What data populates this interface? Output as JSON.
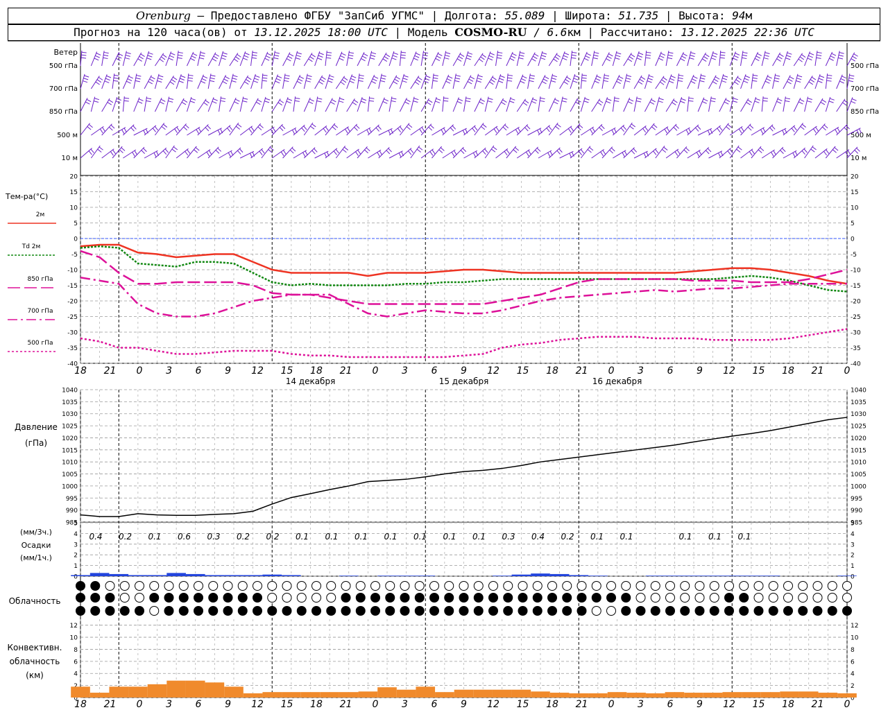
{
  "header": {
    "city": "Orenburg",
    "dash": "—",
    "provider": "Предоставлено ФГБУ \"ЗапСиб УГМС\"",
    "lon_label": "Долгота:",
    "lon": "55.089",
    "lat_label": "Широта:",
    "lat": "51.735",
    "alt_label": "Высота:",
    "alt": "94",
    "alt_unit": "м",
    "sep": "|",
    "forecast_prefix": "Прогноз на 120 часа(ов) от",
    "forecast_start": "13.12.2025 18:00 UTC",
    "model_label": "Модель",
    "model": "COSMO-RU",
    "model_res": "/ 6.6",
    "model_res_unit": "км",
    "computed_label": "Рассчитано:",
    "computed": "13.12.2025 22:36 UTC"
  },
  "time_axis": {
    "hour_labels": [
      "18",
      "21",
      "0",
      "3",
      "6",
      "9",
      "12",
      "15",
      "18",
      "21",
      "0",
      "3",
      "6",
      "9",
      "12",
      "15",
      "18",
      "21",
      "0",
      "3",
      "6",
      "9",
      "12",
      "15",
      "18",
      "21",
      "0"
    ],
    "day_labels": [
      "14 декабря",
      "15 декабря",
      "16 декабря"
    ]
  },
  "wind_panel": {
    "title": "Ветер",
    "levels": [
      "500 гПа",
      "700 гПа",
      "850 гПа",
      "500 м",
      "10 м"
    ],
    "color": "#6a1fc8"
  },
  "temp_panel": {
    "title": "Тем-ра(°C)",
    "legend": [
      "2м",
      "Td 2м",
      "850 гПа",
      "700 гПа",
      "500 гПа"
    ],
    "ticks": [
      "20",
      "15",
      "10",
      "5",
      "0",
      "-5",
      "-10",
      "-15",
      "-20",
      "-25",
      "-30",
      "-35",
      "-40"
    ]
  },
  "pressure_panel": {
    "title": "Давление",
    "unit": "(гПа)",
    "ticks": [
      "1040",
      "1035",
      "1030",
      "1025",
      "1020",
      "1015",
      "1010",
      "1005",
      "1000",
      "995",
      "990",
      "985"
    ]
  },
  "precip_panel": {
    "title": "Осадки",
    "unit_3h": "(мм/3ч.)",
    "unit_1h": "(мм/1ч.)",
    "ticks": [
      "5",
      "4",
      "3",
      "2",
      "1",
      "0"
    ],
    "amounts_3h": [
      "0.4",
      "0.2",
      "0.1",
      "0.6",
      "0.3",
      "0.2",
      "0.2",
      "0.1",
      "0.1",
      "0.1",
      "0.1",
      "0.1",
      "0.1",
      "0.1",
      "0.3",
      "0.4",
      "0.2",
      "0.1",
      "0.1",
      "",
      "0.1",
      "0.1",
      "0.1",
      "",
      "",
      "",
      ""
    ]
  },
  "cloud_panel": {
    "title": "Облачность"
  },
  "conv_panel": {
    "title_1": "Конвективн.",
    "title_2": "облачность",
    "unit": "(км)",
    "ticks": [
      "12",
      "10",
      "8",
      "6",
      "4",
      "2",
      "0"
    ]
  },
  "colors": {
    "t2m": "#ee3322",
    "td2m": "#118811",
    "t850": "#dd1199",
    "t700": "#dd1199",
    "t500": "#dd1199",
    "pressure": "#000000",
    "precip": "#2244dd",
    "conv": "#f08a2c",
    "zero_line": "#3355ff"
  },
  "chart_data": [
    {
      "type": "line",
      "title": "Тем-ра(°C)",
      "x_unit": "hours from 13.12.2025 18:00 UTC",
      "ylim": [
        -40,
        20
      ],
      "x": [
        0,
        3,
        6,
        9,
        12,
        15,
        18,
        21,
        24,
        27,
        30,
        33,
        36,
        39,
        42,
        45,
        48,
        51,
        54,
        57,
        60,
        63,
        66,
        69,
        72,
        75,
        78,
        81,
        84,
        87,
        90,
        93,
        96,
        99,
        102,
        105,
        108,
        111,
        114,
        117,
        120
      ],
      "series": [
        {
          "name": "2м",
          "values": [
            -2.5,
            -2,
            -2,
            -4.5,
            -5,
            -6,
            -5.5,
            -5,
            -5,
            -7.5,
            -10,
            -11,
            -11,
            -11,
            -11,
            -12,
            -11,
            -11,
            -11,
            -10.5,
            -10,
            -10,
            -10.5,
            -11,
            -11,
            -11,
            -11,
            -11,
            -11,
            -11,
            -11,
            -11,
            -10.5,
            -10,
            -9.5,
            -9.5,
            -10,
            -11,
            -12,
            -13.5,
            -14.5
          ]
        },
        {
          "name": "Td 2м",
          "values": [
            -3,
            -2.5,
            -3,
            -8,
            -8.5,
            -9,
            -7.5,
            -7.5,
            -8,
            -11,
            -14,
            -15,
            -14.5,
            -15,
            -15,
            -15,
            -15,
            -14.5,
            -14.5,
            -14,
            -14,
            -13.5,
            -13,
            -13,
            -13,
            -13,
            -13,
            -13,
            -13,
            -13,
            -13,
            -13,
            -13,
            -13,
            -12.5,
            -12,
            -12.5,
            -13.5,
            -15,
            -16.5,
            -17
          ]
        },
        {
          "name": "850 гПа",
          "values": [
            -4,
            -6,
            -11,
            -14.5,
            -14.5,
            -14,
            -14,
            -14,
            -14,
            -15,
            -17.5,
            -18,
            -18,
            -19,
            -20,
            -21,
            -21,
            -21,
            -21,
            -21,
            -21,
            -21,
            -20,
            -19,
            -18,
            -16,
            -14,
            -13,
            -13,
            -13,
            -13,
            -13,
            -13.5,
            -13.5,
            -13.5,
            -14,
            -14,
            -14,
            -13,
            -11.5,
            -10
          ]
        },
        {
          "name": "700 гПа",
          "values": [
            -12.5,
            -13.5,
            -14.5,
            -21,
            -24,
            -25,
            -25,
            -24,
            -22,
            -20,
            -19,
            -18,
            -18,
            -18,
            -21,
            -24,
            -25,
            -24,
            -23,
            -23.5,
            -24,
            -24,
            -23,
            -21.5,
            -20,
            -19,
            -18.5,
            -18,
            -17.5,
            -17,
            -16.5,
            -17,
            -16.5,
            -16,
            -16,
            -15.5,
            -15,
            -14.5,
            -14.5,
            -14.5,
            -14.5
          ]
        },
        {
          "name": "500 гПа",
          "values": [
            -32,
            -33,
            -35,
            -35,
            -36,
            -37,
            -37,
            -36.5,
            -36,
            -36,
            -36,
            -37,
            -37.5,
            -37.5,
            -38,
            -38,
            -38,
            -38,
            -38,
            -38,
            -37.5,
            -37,
            -35,
            -34,
            -33.5,
            -32.5,
            -32,
            -31.5,
            -31.5,
            -31.5,
            -32,
            -32,
            -32,
            -32.5,
            -32.5,
            -32.5,
            -32.5,
            -32,
            -31,
            -30,
            -29
          ]
        }
      ]
    },
    {
      "type": "line",
      "title": "Давление",
      "ylabel": "(гПа)",
      "ylim": [
        985,
        1040
      ],
      "x": [
        0,
        3,
        6,
        9,
        12,
        15,
        18,
        21,
        24,
        27,
        30,
        33,
        36,
        39,
        42,
        45,
        48,
        51,
        54,
        57,
        60,
        63,
        66,
        69,
        72,
        75,
        78,
        81,
        84,
        87,
        90,
        93,
        96,
        99,
        102,
        105,
        108,
        111,
        114,
        117,
        120
      ],
      "series": [
        {
          "name": "Давление",
          "values": [
            988,
            987.3,
            987.3,
            988.5,
            988,
            987.8,
            987.8,
            988.2,
            988.5,
            989.5,
            992.5,
            995.2,
            996.8,
            998.5,
            1000,
            1001.8,
            1002.3,
            1002.8,
            1003.8,
            1005,
            1006,
            1006.5,
            1007.3,
            1008.5,
            1010,
            1011,
            1012,
            1013,
            1014,
            1015,
            1016,
            1017,
            1018.3,
            1019.5,
            1020.7,
            1021.8,
            1023,
            1024.5,
            1026,
            1027.5,
            1028.5
          ]
        }
      ]
    },
    {
      "type": "bar",
      "title": "Осадки",
      "ylabel": "(мм/1ч.)",
      "ylim": [
        0,
        5
      ],
      "x": [
        0,
        3,
        6,
        9,
        12,
        15,
        18,
        21,
        24,
        27,
        30,
        33,
        36,
        39,
        42,
        45,
        48,
        51,
        54,
        57,
        60,
        63,
        66,
        69,
        72,
        75,
        78,
        81,
        84,
        87,
        90,
        93,
        96,
        99,
        102,
        105,
        108,
        111,
        114,
        117,
        120
      ],
      "values": [
        0.1,
        0.3,
        0.2,
        0.1,
        0.1,
        0.3,
        0.2,
        0.1,
        0.1,
        0.1,
        0.15,
        0.1,
        0,
        0,
        0.05,
        0,
        0.05,
        0.05,
        0.05,
        0,
        0,
        0,
        0.05,
        0.15,
        0.25,
        0.2,
        0.1,
        0.05,
        0,
        0,
        0.05,
        0.05,
        0.05,
        0.05,
        0.05,
        0.05,
        0.05,
        0,
        0,
        0,
        0.05
      ]
    },
    {
      "type": "bar",
      "title": "Конвективн. облачность",
      "ylabel": "(км)",
      "ylim": [
        0,
        13
      ],
      "x": [
        0,
        3,
        6,
        9,
        12,
        15,
        18,
        21,
        24,
        27,
        30,
        33,
        36,
        39,
        42,
        45,
        48,
        51,
        54,
        57,
        60,
        63,
        66,
        69,
        72,
        75,
        78,
        81,
        84,
        87,
        90,
        93,
        96,
        99,
        102,
        105,
        108,
        111,
        114,
        117,
        120
      ],
      "values": [
        1.8,
        0.8,
        1.8,
        1.8,
        2.2,
        2.8,
        2.8,
        2.5,
        1.8,
        0.7,
        0.9,
        0.9,
        0.9,
        0.9,
        0.9,
        1,
        1.7,
        1.3,
        1.8,
        0.9,
        1.3,
        1.3,
        1.3,
        1.3,
        1,
        0.8,
        0.7,
        0.7,
        0.9,
        0.8,
        0.7,
        0.9,
        0.8,
        0.8,
        0.9,
        0.9,
        0.9,
        1,
        1,
        0.8,
        0.7
      ]
    }
  ]
}
